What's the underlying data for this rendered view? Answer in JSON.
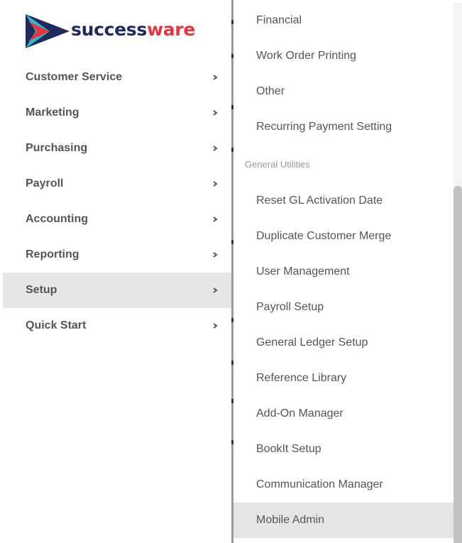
{
  "brand": {
    "name_part1": "success",
    "name_part2": "ware",
    "color_dark": "#1f2a5e",
    "color_red": "#e63440"
  },
  "sidebar": {
    "items": [
      {
        "label": "Customer Service",
        "icon": "chevron-right-icon"
      },
      {
        "label": "Marketing",
        "icon": "chevron-right-icon"
      },
      {
        "label": "Purchasing",
        "icon": "chevron-right-icon"
      },
      {
        "label": "Payroll",
        "icon": "chevron-right-icon"
      },
      {
        "label": "Accounting",
        "icon": "chevron-right-icon"
      },
      {
        "label": "Reporting",
        "icon": "chevron-right-icon"
      },
      {
        "label": "Setup",
        "icon": "chevron-right-icon",
        "active": true
      },
      {
        "label": "Quick Start",
        "icon": "chevron-right-icon"
      }
    ]
  },
  "submenu": {
    "items_top": [
      {
        "label": "Financial"
      },
      {
        "label": "Work Order Printing"
      },
      {
        "label": "Other"
      },
      {
        "label": "Recurring Payment Setting"
      }
    ],
    "section_header": "General Utilities",
    "items_bottom": [
      {
        "label": "Reset GL Activation Date"
      },
      {
        "label": "Duplicate Customer Merge"
      },
      {
        "label": "User Management"
      },
      {
        "label": "Payroll Setup"
      },
      {
        "label": "General Ledger Setup"
      },
      {
        "label": "Reference Library"
      },
      {
        "label": "Add-On Manager"
      },
      {
        "label": "BookIt Setup"
      },
      {
        "label": "Communication Manager"
      },
      {
        "label": "Mobile Admin",
        "active": true
      }
    ]
  },
  "colors": {
    "active_bg": "#e7e7e7",
    "text": "#555555",
    "section_header_text": "#999999"
  }
}
